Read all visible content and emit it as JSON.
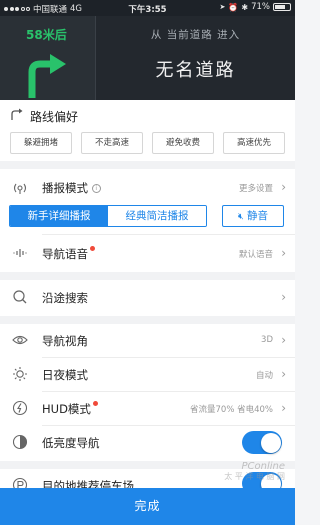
{
  "status": {
    "carrier": "中国联通",
    "network": "4G",
    "time": "下午3:55",
    "battery": "71%",
    "battery_level": 0.71
  },
  "nav": {
    "distance": "58米后",
    "from_text": "从 当前道路 进入",
    "road_name": "无名道路"
  },
  "route_pref": {
    "title": "路线偏好",
    "options": [
      "躲避拥堵",
      "不走高速",
      "避免收费",
      "高速优先"
    ]
  },
  "broadcast": {
    "label": "播报模式",
    "more": "更多设置",
    "modes": [
      "新手详细播报",
      "经典简洁播报"
    ],
    "mute": "静音"
  },
  "rows": {
    "voice": {
      "label": "导航语音",
      "value": "默认语音"
    },
    "search": {
      "label": "沿途搜索"
    },
    "view": {
      "label": "导航视角",
      "value": "3D"
    },
    "daynight": {
      "label": "日夜模式",
      "value": "自动"
    },
    "hud": {
      "label": "HUD模式",
      "value": "省流量70% 省电40%"
    },
    "lowbright": {
      "label": "低亮度导航",
      "on": true
    },
    "parking": {
      "label": "目的地推荐停车场",
      "on": true
    }
  },
  "footer": {
    "done": "完成"
  },
  "watermark": {
    "line1": "PConline",
    "line2": "太 平 洋 电 脑 网"
  },
  "colors": {
    "accent": "#1f86e8",
    "nav_green": "#29c26b",
    "badge_red": "#f04a3a"
  }
}
